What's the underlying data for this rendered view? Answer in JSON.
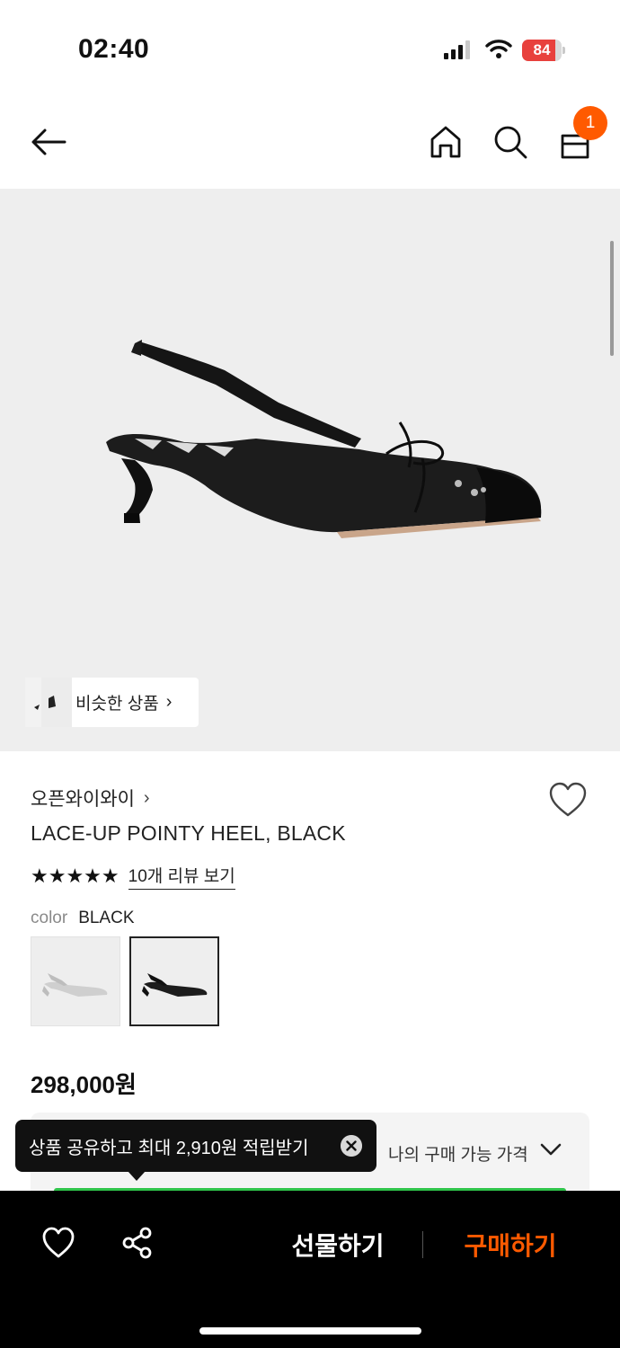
{
  "status_bar": {
    "time": "02:40",
    "battery_level": "84",
    "battery_text": "84",
    "battery_color": "#e8413d"
  },
  "header": {
    "back_icon": "arrow-left-icon",
    "home_icon": "home-icon",
    "search_icon": "search-icon",
    "cart_icon": "shopping-bag-icon",
    "cart_count": "1",
    "badge_color": "#ff5a00"
  },
  "hero": {
    "similar_products_label": "비슷한 상품",
    "similar_chevron": "›"
  },
  "product": {
    "brand": "오픈와이와이",
    "brand_chevron": "›",
    "title": "LACE-UP POINTY HEEL, BLACK",
    "stars": "★★★★★",
    "rating": 5,
    "review_link": "10개 리뷰 보기",
    "color_key": "color",
    "color_value": "BLACK",
    "swatches": [
      "silver",
      "black"
    ],
    "selected_swatch": "black",
    "price": "298,000원"
  },
  "price_panel": {
    "label": "나의 구매 가능 가격"
  },
  "tooltip": {
    "text": "상품 공유하고 최대 2,910원 적립받기"
  },
  "bottom_bar": {
    "gift_label": "선물하기",
    "buy_label": "구매하기",
    "buy_color": "#ff5a00"
  }
}
